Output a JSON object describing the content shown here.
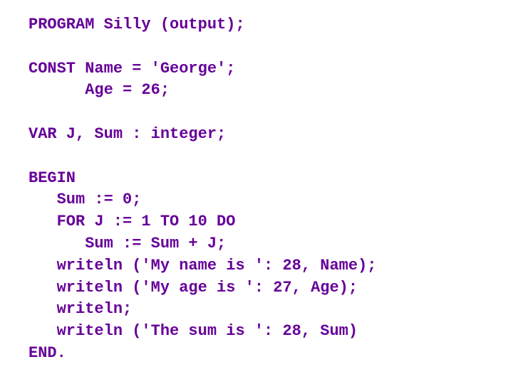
{
  "code": {
    "lines": [
      "PROGRAM Silly (output);",
      "",
      "CONST Name = 'George';",
      "      Age = 26;",
      "",
      "VAR J, Sum : integer;",
      "",
      "BEGIN",
      "   Sum := 0;",
      "   FOR J := 1 TO 10 DO",
      "      Sum := Sum + J;",
      "   writeln ('My name is ': 28, Name);",
      "   writeln ('My age is ': 27, Age);",
      "   writeln;",
      "   writeln ('The sum is ': 28, Sum)",
      "END."
    ]
  }
}
